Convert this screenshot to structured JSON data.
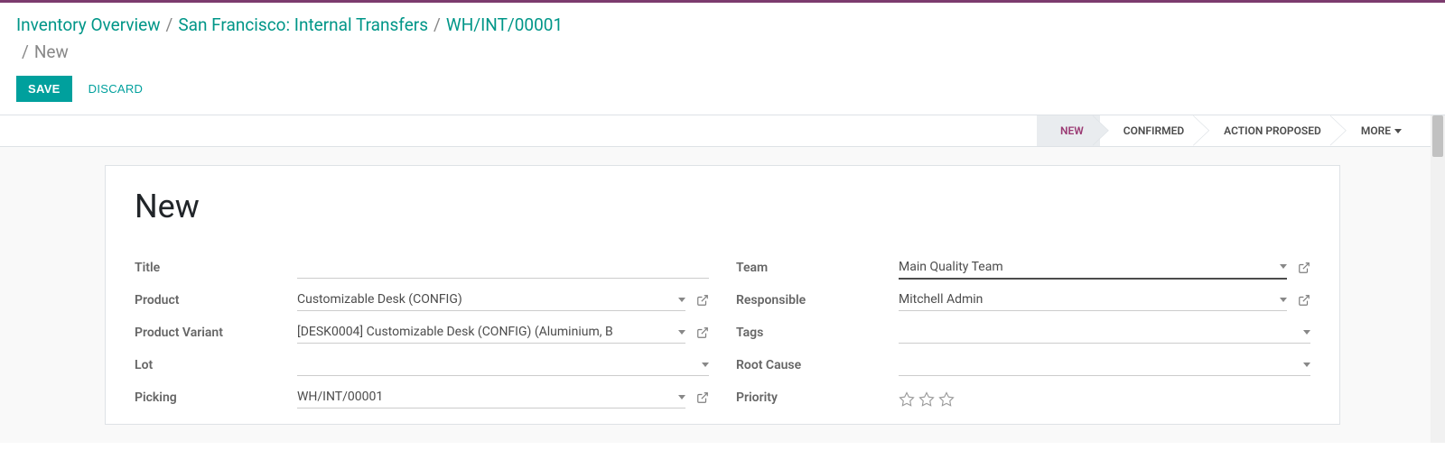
{
  "breadcrumb": {
    "items": [
      {
        "label": "Inventory Overview"
      },
      {
        "label": "San Francisco: Internal Transfers"
      },
      {
        "label": "WH/INT/00001"
      }
    ],
    "current": "New",
    "sep": "/"
  },
  "actions": {
    "save": "SAVE",
    "discard": "DISCARD"
  },
  "status": {
    "new": "NEW",
    "confirmed": "CONFIRMED",
    "action_proposed": "ACTION PROPOSED",
    "more": "MORE"
  },
  "form": {
    "title": "New",
    "left": {
      "title_label": "Title",
      "title_value": "",
      "product_label": "Product",
      "product_value": "Customizable Desk (CONFIG)",
      "variant_label": "Product Variant",
      "variant_value": "[DESK0004] Customizable Desk (CONFIG) (Aluminium, B",
      "lot_label": "Lot",
      "lot_value": "",
      "picking_label": "Picking",
      "picking_value": "WH/INT/00001"
    },
    "right": {
      "team_label": "Team",
      "team_value": "Main Quality Team",
      "responsible_label": "Responsible",
      "responsible_value": "Mitchell Admin",
      "tags_label": "Tags",
      "tags_value": "",
      "root_cause_label": "Root Cause",
      "root_cause_value": "",
      "priority_label": "Priority"
    }
  }
}
